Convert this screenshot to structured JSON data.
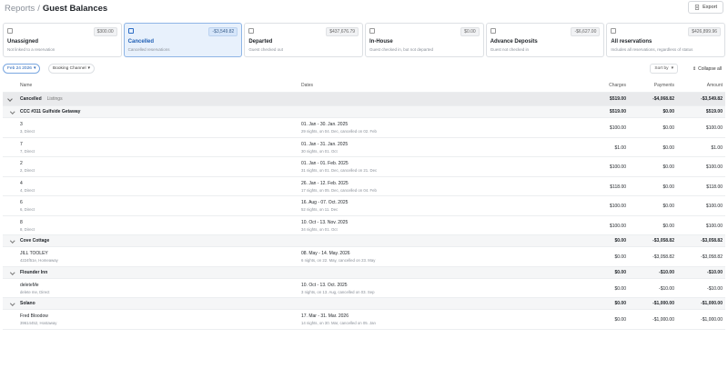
{
  "header": {
    "breadcrumb": "Reports",
    "separator": "/",
    "title": "Guest Balances",
    "export_label": "Export"
  },
  "cards": [
    {
      "title": "Unassigned",
      "subtitle": "Not linked to a reservation",
      "badge": "$300.00",
      "active": false,
      "icon": "unassigned-icon"
    },
    {
      "title": "Cancelled",
      "subtitle": "Cancelled reservations",
      "badge": "-$3,549.82",
      "active": true,
      "icon": "cancelled-icon"
    },
    {
      "title": "Departed",
      "subtitle": "Guest checked out",
      "badge": "$437,676.79",
      "active": false,
      "icon": "departed-icon"
    },
    {
      "title": "In-House",
      "subtitle": "Guest checked in, but not departed",
      "badge": "$0.00",
      "active": false,
      "icon": "in-house-icon"
    },
    {
      "title": "Advance Deposits",
      "subtitle": "Guest not checked in",
      "badge": "-$6,627.00",
      "active": false,
      "icon": "advance-deposits-icon"
    },
    {
      "title": "All reservations",
      "subtitle": "Includes all reservations, regardless of status",
      "badge": "$426,899.96",
      "active": false,
      "icon": "all-reservations-icon"
    }
  ],
  "filters": {
    "date_chip": "Feb 24 2026",
    "booking_chip": "Booking Channel",
    "sort_label": "Sort by",
    "collapse_label": "Collapse all"
  },
  "table": {
    "headers": {
      "name": "Name",
      "dates": "Dates",
      "charges": "Charges",
      "payments": "Payments",
      "amount": "Amount"
    },
    "group": {
      "name": "Cancelled",
      "tag": "Listings",
      "charges": "$519.00",
      "payments": "-$4,068.82",
      "amount": "-$3,549.82"
    },
    "properties": [
      {
        "name": "CCC #311 Gulfside Getaway",
        "charges": "$519.00",
        "payments": "$0.00",
        "amount": "$519.00",
        "reservations": [
          {
            "name": "3",
            "sub": "3, Direct",
            "dates": "01. Jan - 30. Jan. 2025",
            "dates_sub": "29 nights, on 04. Dec, cancelled on 02. Feb",
            "charges": "$100.00",
            "payments": "$0.00",
            "amount": "$100.00"
          },
          {
            "name": "7",
            "sub": "7, Direct",
            "dates": "01. Jan - 31. Jan. 2025",
            "dates_sub": "30 nights, on 01. Oct",
            "charges": "$1.00",
            "payments": "$0.00",
            "amount": "$1.00"
          },
          {
            "name": "2",
            "sub": "2, Direct",
            "dates": "01. Jan - 01. Feb. 2025",
            "dates_sub": "31 nights, on 01. Dec, cancelled on 21. Dec",
            "charges": "$100.00",
            "payments": "$0.00",
            "amount": "$100.00"
          },
          {
            "name": "4",
            "sub": "4, Direct",
            "dates": "26. Jan - 12. Feb. 2025",
            "dates_sub": "17 nights, on 05. Dec, cancelled on 04. Feb",
            "charges": "$118.00",
            "payments": "$0.00",
            "amount": "$118.00"
          },
          {
            "name": "6",
            "sub": "6, Direct",
            "dates": "16. Aug - 07. Oct. 2025",
            "dates_sub": "52 nights, on 11. Dec",
            "charges": "$100.00",
            "payments": "$0.00",
            "amount": "$100.00"
          },
          {
            "name": "8",
            "sub": "8, Direct",
            "dates": "10. Oct - 13. Nov. 2025",
            "dates_sub": "34 nights, on 01. Oct",
            "charges": "$100.00",
            "payments": "$0.00",
            "amount": "$100.00"
          }
        ]
      },
      {
        "name": "Cove Cottage",
        "charges": "$0.00",
        "payments": "-$3,058.82",
        "amount": "-$3,058.82",
        "reservations": [
          {
            "name": "JILL TOOLEY",
            "sub": "4224f51e, Homeaway",
            "dates": "08. May - 14. May. 2026",
            "dates_sub": "6 nights, on 22. May, cancelled on 23. May",
            "charges": "$0.00",
            "payments": "-$3,058.82",
            "amount": "-$3,058.82"
          }
        ]
      },
      {
        "name": "Flounder Inn",
        "charges": "$0.00",
        "payments": "-$10.00",
        "amount": "-$10.00",
        "reservations": [
          {
            "name": "deleteMe",
            "sub": "delete me, Direct",
            "dates": "10. Oct - 13. Oct. 2025",
            "dates_sub": "3 nights, on 13. Aug, cancelled on 03. Sep",
            "charges": "$0.00",
            "payments": "-$10.00",
            "amount": "-$10.00"
          }
        ]
      },
      {
        "name": "Solano",
        "charges": "$0.00",
        "payments": "-$1,000.00",
        "amount": "-$1,000.00",
        "reservations": [
          {
            "name": "Fred Bloodow",
            "sub": "39614452, Hostaway",
            "dates": "17. Mar - 31. Mar. 2026",
            "dates_sub": "14 nights, on 30. Mar, cancelled on 05. Jan",
            "charges": "$0.00",
            "payments": "-$1,000.00",
            "amount": "-$1,000.00"
          }
        ]
      }
    ]
  }
}
